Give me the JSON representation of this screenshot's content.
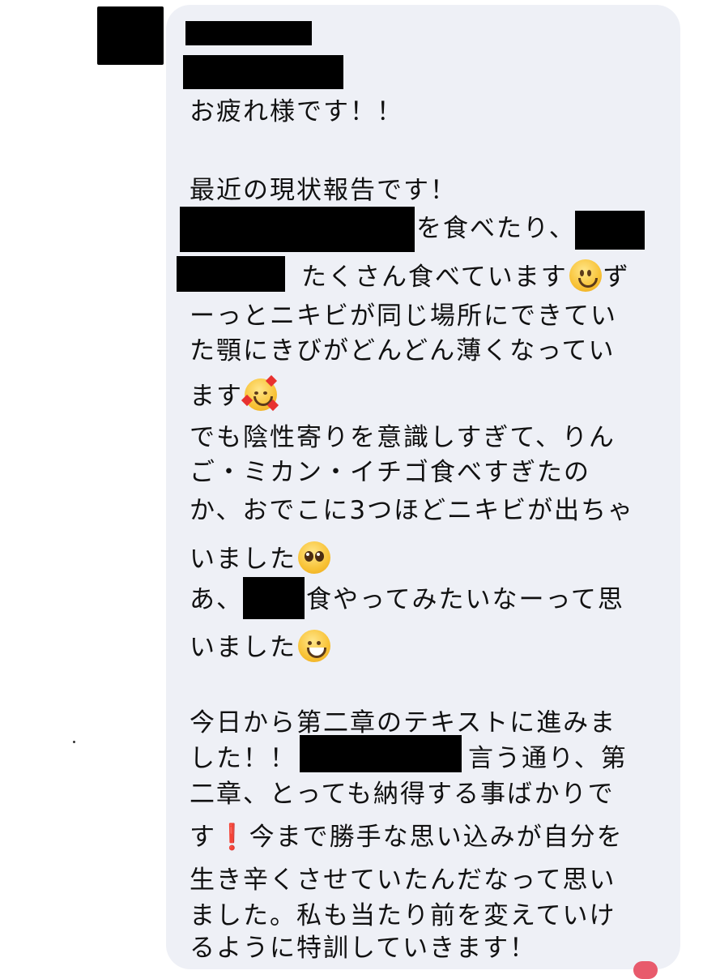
{
  "message": {
    "lines": [
      "お疲れ様です！！",
      "最近の現状報告です！",
      "を食べたり、",
      "たくさん食べています",
      "ず",
      "ーっとニキビが同じ場所にできてい",
      "た顎にきびがどんどん薄くなってい",
      "ます",
      "でも陰性寄りを意識しすぎて、りん",
      "ご・ミカン・イチゴ食べすぎたの",
      "か、おでこに3つほどニキビが出ちゃ",
      "いました",
      "あ、",
      "食やってみたいなーって思",
      "いました",
      "今日から第二章のテキストに進みま",
      "した！！",
      "言う通り、第",
      "二章、とっても納得する事ばかりで",
      "す",
      "今まで勝手な思い込みが自分を",
      "生き辛くさせていたんだなって思い",
      "ました。私も当たり前を変えていけ",
      "るように特訓していきます！"
    ],
    "exclamation": "❗"
  },
  "emojis": [
    "slightly-smiling-face",
    "smiling-face-with-hearts",
    "pleading-face",
    "grinning-face"
  ],
  "colors": {
    "bubble": "#eef0f6",
    "text": "#111111",
    "redaction": "#000000"
  }
}
